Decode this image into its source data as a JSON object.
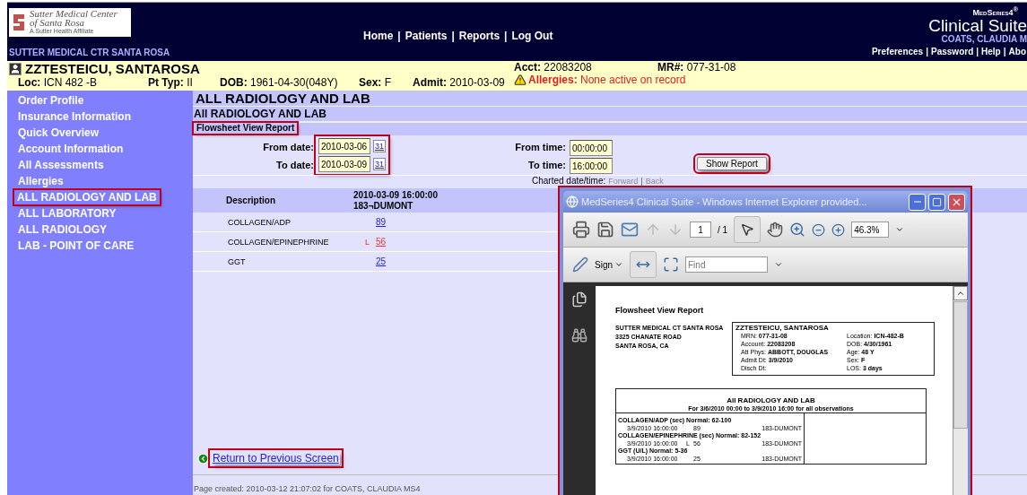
{
  "header": {
    "logo": {
      "lines": [
        "Sutter Medical Center",
        "of Santa Rosa",
        "A Sutter Health Affiliate"
      ]
    },
    "facility": "SUTTER MEDICAL CTR SANTA ROSA",
    "nav": [
      {
        "label": "Home"
      },
      {
        "separator": "|",
        "label": "Patients"
      },
      {
        "separator": "|",
        "label": "Reports"
      },
      {
        "separator": "|",
        "label": "Log Out"
      }
    ],
    "brand": {
      "series": "MedSeries4$^{®}$",
      "product": "Clinical Suite",
      "user": "COATS, CLAUDIA M"
    },
    "user_links": [
      {
        "label": "Preferences"
      },
      {
        "separator": "|",
        "label": "Password"
      },
      {
        "separator": "|",
        "label": "Help"
      },
      {
        "separator": "|",
        "label": "Abo"
      }
    ]
  },
  "patient": {
    "name": "ZZTESTEICU, SANTAROSA",
    "acct": {
      "label": "Acct:",
      "value": "22083208"
    },
    "mrn": {
      "label": "MR#:",
      "value": "077-31-08"
    },
    "fields": [
      {
        "label": "Loc:",
        "value": "ICN 482 -B"
      },
      {
        "label": "Pt Typ:",
        "value": "II"
      },
      {
        "label": "DOB:",
        "value": "1961-04-30(048Y)"
      },
      {
        "label": "Sex:",
        "value": "F"
      },
      {
        "label": "Admit:",
        "value": "2010-03-09"
      }
    ],
    "allergies": {
      "label": "Allergies:",
      "value": "None active on record"
    }
  },
  "sidebar": {
    "items": [
      {
        "label": "Order Profile",
        "selected": false
      },
      {
        "label": "Insurance Information",
        "selected": false
      },
      {
        "label": "Quick Overview",
        "selected": false
      },
      {
        "label": "Account Information",
        "selected": false
      },
      {
        "label": "All Assessments",
        "selected": false
      },
      {
        "label": "Allergies",
        "selected": false
      },
      {
        "label": "ALL RADIOLOGY AND LAB",
        "selected": true
      },
      {
        "label": "ALL LABORATORY",
        "selected": false
      },
      {
        "label": "ALL RADIOLOGY",
        "selected": false
      },
      {
        "label": "LAB - POINT OF CARE",
        "selected": false
      }
    ]
  },
  "content": {
    "title": "ALL RADIOLOGY AND LAB",
    "subtitle": "All RADIOLOGY AND LAB",
    "section": {
      "label": "Flowsheet View Report",
      "highlighted": true
    },
    "dates_highlighted": true,
    "dates": [
      {
        "label": "From date:",
        "value": "2010-03-06",
        "calendar": "31"
      },
      {
        "label": "To date:",
        "value": "2010-03-09",
        "calendar": "31"
      }
    ],
    "times": [
      {
        "label": "From time:",
        "value": "00:00:00"
      },
      {
        "label": "To time:",
        "value": "16:00:00"
      }
    ],
    "show_report": {
      "label": "Show Report",
      "highlighted": true
    },
    "charted": {
      "label": "Charted date/time:",
      "links": [
        {
          "label": "Forward",
          "disabled": true
        },
        {
          "separator": "|",
          "label": "Back",
          "disabled": true
        }
      ]
    },
    "table": {
      "description_header": "Description",
      "column_header": [
        "2010-03-09 16:00:00",
        "183¬DUMONT"
      ],
      "rows": [
        {
          "description": "COLLAGEN/ADP",
          "value": "89",
          "abnormal": false
        },
        {
          "description": "COLLAGEN/EPINEPHRINE",
          "flag": "L",
          "value": "56",
          "abnormal": true
        },
        {
          "description": "GGT",
          "value": "25",
          "abnormal": false
        }
      ]
    },
    "return_link": {
      "label": "Return to Previous Screen",
      "highlighted": true
    },
    "footer": "Page created: 2010-03-12 21:07:02 for COATS, CLAUDIA MS4"
  },
  "popup": {
    "title": "MedSeries4 Clinical Suite - Windows Internet Explorer provided...",
    "highlighted": true,
    "toolbar": {
      "page": "1",
      "page_total": "/ 1",
      "zoom": "46.3%",
      "sign": "Sign",
      "find_placeholder": "Find"
    },
    "document": {
      "title": "Flowsheet View Report",
      "facility": [
        "SUTTER MEDICAL CT SANTA ROSA",
        "3325 CHANATE ROAD",
        "SANTA ROSA, CA"
      ],
      "patient_name": "ZZTESTEICU, SANTAROSA",
      "left_fields": [
        {
          "label": "MRN:",
          "value": "077-31-08"
        },
        {
          "label": "Account:",
          "value": "22083208"
        },
        {
          "label": "Att Phys:",
          "value": "ABBOTT, DOUGLAS"
        },
        {
          "label": "Admit Dt:",
          "value": "3/9/2010"
        },
        {
          "label": "Disch Dt:"
        }
      ],
      "right_fields": [
        {
          "label": "Location:",
          "value": "ICN-482-B"
        },
        {
          "label": "DOB:",
          "value": "4/30/1961"
        },
        {
          "label": "Age:",
          "value": "48 Y"
        },
        {
          "label": "Sex:",
          "value": "F"
        },
        {
          "label": "LOS:",
          "value": "3 days"
        }
      ],
      "report_title": "All RADIOLOGY AND LAB",
      "report_range": "For 3/6/2010 00:00 to 3/9/2010 16:00 for all observations",
      "groups": [
        {
          "heading": "COLLAGEN/ADP (sec) Normal: 62-100",
          "time": "3/9/2010 16:00:00",
          "value": "89",
          "by": "183-DUMONT"
        },
        {
          "heading": "COLLAGEN/EPINEPHRINE (sec) Normal: 82-152",
          "time": "3/9/2010 16:00:00",
          "flag": "L",
          "value": "56",
          "by": "183-DUMONT"
        },
        {
          "heading": "GGT (U/L) Normal: 5-36",
          "time": "3/9/2010 16:00:00",
          "value": "25",
          "by": "183-DUMONT"
        }
      ]
    }
  }
}
